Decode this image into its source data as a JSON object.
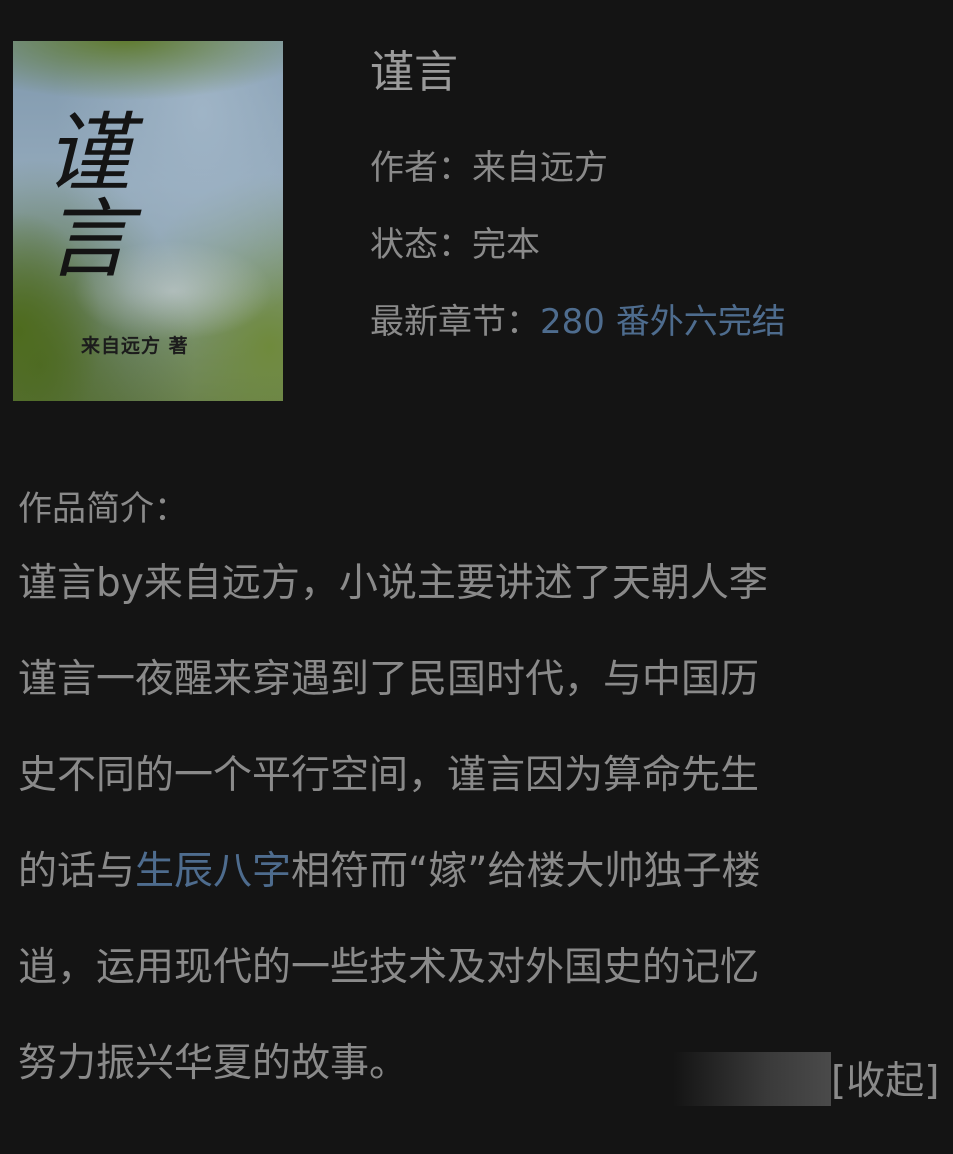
{
  "cover": {
    "title_art": "谨 言",
    "author_art": "来自远方 著"
  },
  "book": {
    "title": "谨言",
    "author_label": "作者：",
    "author": "来自远方",
    "status_label": "状态：",
    "status": "完本",
    "latest_label": "最新章节：",
    "latest_chapter": "280 番外六完结"
  },
  "intro": {
    "label": "作品简介：",
    "lines": {
      "l1": "谨言by来自远方，小说主要讲述了天朝人李",
      "l2": "谨言一夜醒来穿遇到了民国时代，与中国历",
      "l3": "史不同的一个平行空间，谨言因为算命先生",
      "l4a": "的话与",
      "l4link": "生辰八字",
      "l4b": "相符而“嫁”给楼大帅独子楼",
      "l5": "逍，运用现代的一些技术及对外国史的记忆",
      "l6": "努力振兴华夏的故事。"
    },
    "collapse_label": "[收起]"
  },
  "colors": {
    "background": "#141414",
    "text": "#8a8a8a",
    "link": "#4e6c8e"
  }
}
